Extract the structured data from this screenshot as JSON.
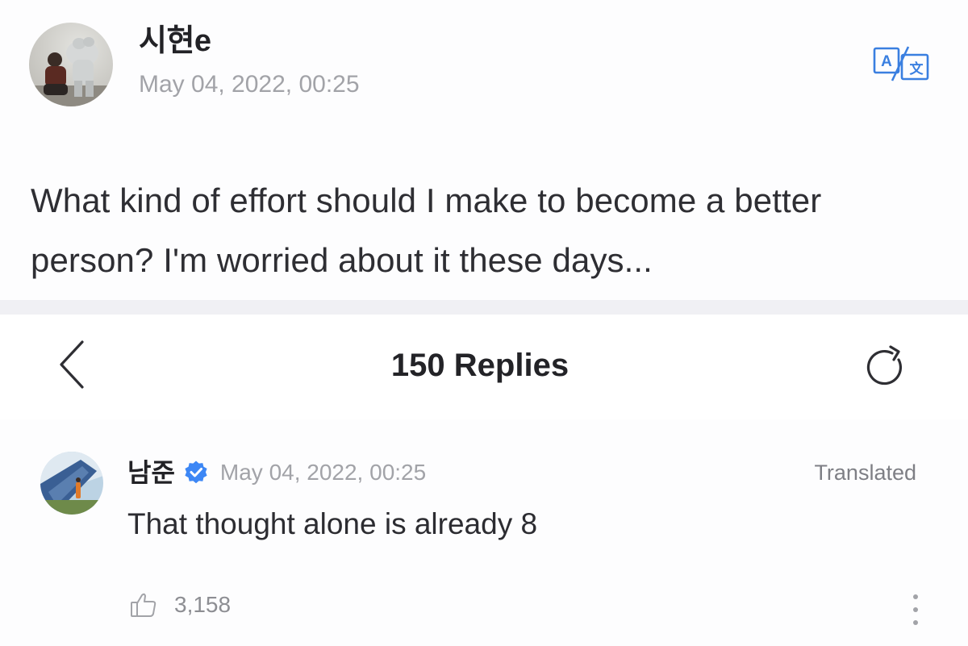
{
  "post": {
    "author": "시현e",
    "date": "May 04, 2022, 00:25",
    "body": "What kind of effort should I make to become a better person? I'm worried about it these days...",
    "translate_icon": "translate-icon"
  },
  "replies_header": {
    "title": "150 Replies",
    "back_icon": "chevron-left-icon",
    "refresh_icon": "refresh-icon"
  },
  "reply": {
    "author": "남준",
    "verified_icon": "verified-badge-icon",
    "date": "May 04, 2022, 00:25",
    "translated_label": "Translated",
    "text": "That thought alone is already 8",
    "like_count": "3,158",
    "like_icon": "thumbs-up-icon",
    "more_icon": "more-vertical-icon"
  },
  "colors": {
    "accent_blue": "#3d87f5",
    "icon_blue": "#3a7fe0",
    "meta_gray": "#a2a3a8",
    "text_dark": "#2b2b2f"
  }
}
